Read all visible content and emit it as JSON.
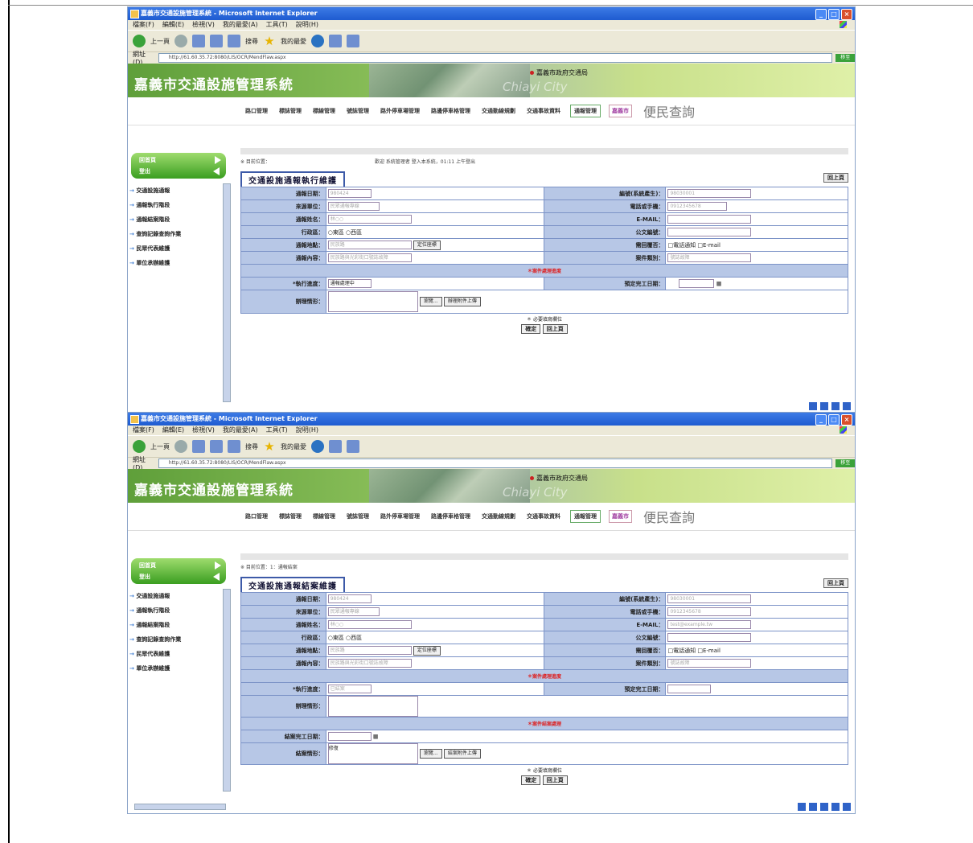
{
  "window": {
    "title": "嘉義市交通設施管理系統 - Microsoft Internet Explorer",
    "menus": [
      "檔案(F)",
      "編輯(E)",
      "檢視(V)",
      "我的最愛(A)",
      "工具(T)",
      "說明(H)"
    ],
    "toolbar": {
      "back": "上一頁",
      "search": "搜尋",
      "favorites": "我的最愛"
    },
    "address_label": "網址(D)",
    "address_1": "http://61.60.35.72:8080/LIS/OCR/MendFlaw.aspx",
    "address_2": "http://61.60.35.72:8080/LIS/OCR/MendFlaw.aspx",
    "go": "移至"
  },
  "banner": {
    "title": "嘉義市交通設施管理系統",
    "dept": "嘉義市政府交通局",
    "city": "Chiayi City"
  },
  "nav": {
    "items": [
      "路口管理",
      "標誌管理",
      "標線管理",
      "號誌管理",
      "路外停車場管理",
      "路邊停車格管理",
      "交通動線規劃",
      "交通事故資料",
      "通報管理",
      "嘉義市",
      "便民查詢"
    ]
  },
  "sidebar": {
    "btn_top": "回首頁",
    "btn_bottom": "登出",
    "items": [
      "交通設施通報",
      "通報執行階段",
      "通報結案階段",
      "查詢記錄查詢作業",
      "民眾代表維護",
      "單位承辦維護"
    ]
  },
  "screen1": {
    "crumb": "※ 目前位置：",
    "welcome": "歡迎 系統管理者 登入本系統，01:11 上午登出",
    "form_title": "交通設施通報執行維護",
    "back_top": "回上頁",
    "labels": {
      "report_date": "通報日期：",
      "serial": "編號(系統產生)：",
      "source": "來源單位：",
      "phone": "電話或手機：",
      "reporter": "通報姓名：",
      "email": "E-MAIL：",
      "district": "行政區：",
      "doc_no": "公文編號：",
      "location": "通報地點：",
      "reply": "需回覆否：",
      "content": "通報內容：",
      "case_type": "案件類別：",
      "section": "＊案件處理進度",
      "exec_status": "*執行進度：",
      "planned_date": "預定完工日期：",
      "remark": "辦理情形："
    },
    "values": {
      "report_date": "980424",
      "serial": "98030001",
      "source": "民眾通報專線",
      "phone": "0912345678",
      "reporter": "林○○",
      "district_opt1": "東區",
      "district_opt2": "西區",
      "location": "民族路",
      "location_btn": "定位座標",
      "reply_opt1": "電話通知",
      "reply_opt2": "E-mail",
      "content": "民族路與光彩街口號誌故障",
      "case_type": "號誌故障",
      "exec_status": "通報處理中",
      "browse": "瀏覽...",
      "upload": "辦理附件上傳"
    },
    "req_note": "＊ 必要填寫欄位",
    "confirm": "確定",
    "back": "回上頁"
  },
  "screen2": {
    "crumb": "※ 目前位置：1：通報結案",
    "form_title": "交通設施通報結案維護",
    "back_top": "回上頁",
    "labels": {
      "report_date": "通報日期：",
      "serial": "編號(系統產生)：",
      "source": "來源單位：",
      "phone": "電話或手機：",
      "reporter": "通報姓名：",
      "email": "E-MAIL：",
      "district": "行政區：",
      "doc_no": "公文編號：",
      "location": "通報地點：",
      "reply": "需回覆否：",
      "content": "通報內容：",
      "case_type": "案件類別：",
      "section1": "＊案件處理進度",
      "exec_status": "*執行進度：",
      "planned_date": "預定完工日期：",
      "remark": "辦理情形：",
      "section2": "＊案件結案處理",
      "finish_date": "結案完工日期：",
      "finish_remark": "結案情形："
    },
    "values": {
      "report_date": "980424",
      "serial": "98030001",
      "source": "民眾通報專線",
      "phone": "0912345678",
      "reporter": "林○○",
      "email": "test@example.tw",
      "district_opt1": "東區",
      "district_opt2": "西區",
      "location": "民族路",
      "location_btn": "定位座標",
      "reply_opt1": "電話通知",
      "reply_opt2": "E-mail",
      "content": "民族路與光彩街口號誌故障",
      "case_type": "號誌故障",
      "exec_status": "已結案",
      "finish_text": "修復",
      "browse": "瀏覽...",
      "upload": "結案附件上傳"
    },
    "req_note": "＊ 必要填寫欄位",
    "confirm": "確定",
    "back": "回上頁"
  }
}
